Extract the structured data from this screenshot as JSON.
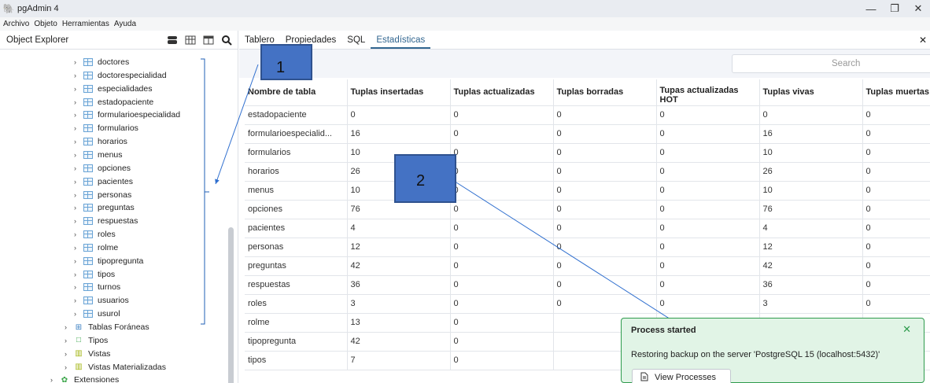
{
  "window": {
    "title": "pgAdmin 4",
    "minimize": "—",
    "restore": "❐",
    "close": "✕"
  },
  "menu": [
    "Archivo",
    "Objeto",
    "Herramientas",
    "Ayuda"
  ],
  "explorer": {
    "title": "Object Explorer",
    "tables": [
      "doctores",
      "doctorespecialidad",
      "especialidades",
      "estadopaciente",
      "formularioespecialidad",
      "formularios",
      "horarios",
      "menus",
      "opciones",
      "pacientes",
      "personas",
      "preguntas",
      "respuestas",
      "roles",
      "rolme",
      "tipopregunta",
      "tipos",
      "turnos",
      "usuarios",
      "usurol"
    ],
    "folders": [
      "Tablas Foráneas",
      "Tipos",
      "Vistas",
      "Vistas Materializadas"
    ],
    "extensions": "Extensiones"
  },
  "tabs": [
    "Tablero",
    "Propiedades",
    "SQL",
    "Estadísticas"
  ],
  "active_tab": "Estadísticas",
  "search": {
    "placeholder": "Search"
  },
  "table": {
    "columns": [
      "Nombre de tabla",
      "Tuplas insertadas",
      "Tuplas actualizadas",
      "Tuplas borradas",
      "Tupas actualizadas HOT",
      "Tuplas vivas",
      "Tuplas muertas"
    ],
    "rows": [
      [
        "estadopaciente",
        "0",
        "0",
        "0",
        "0",
        "0",
        "0"
      ],
      [
        "formularioespecialid...",
        "16",
        "0",
        "0",
        "0",
        "16",
        "0"
      ],
      [
        "formularios",
        "10",
        "0",
        "0",
        "0",
        "10",
        "0"
      ],
      [
        "horarios",
        "26",
        "0",
        "0",
        "0",
        "26",
        "0"
      ],
      [
        "menus",
        "10",
        "0",
        "0",
        "0",
        "10",
        "0"
      ],
      [
        "opciones",
        "76",
        "0",
        "0",
        "0",
        "76",
        "0"
      ],
      [
        "pacientes",
        "4",
        "0",
        "0",
        "0",
        "4",
        "0"
      ],
      [
        "personas",
        "12",
        "0",
        "0",
        "0",
        "12",
        "0"
      ],
      [
        "preguntas",
        "42",
        "0",
        "0",
        "0",
        "42",
        "0"
      ],
      [
        "respuestas",
        "36",
        "0",
        "0",
        "0",
        "36",
        "0"
      ],
      [
        "roles",
        "3",
        "0",
        "0",
        "0",
        "3",
        "0"
      ],
      [
        "rolme",
        "13",
        "0",
        "",
        "",
        "",
        ""
      ],
      [
        "tipopregunta",
        "42",
        "0",
        "",
        "",
        "",
        ""
      ],
      [
        "tipos",
        "7",
        "0",
        "",
        "",
        "",
        ""
      ]
    ]
  },
  "callouts": [
    "1",
    "2"
  ],
  "notification": {
    "title": "Process started",
    "message": "Restoring backup on the server 'PostgreSQL 15 (localhost:5432)'",
    "button": "View Processes",
    "close": "✕"
  },
  "colors": {
    "accent": "#326690",
    "callout": "#4472c4",
    "toast_bg": "#e1f4e6",
    "toast_border": "#2e9b4d"
  }
}
